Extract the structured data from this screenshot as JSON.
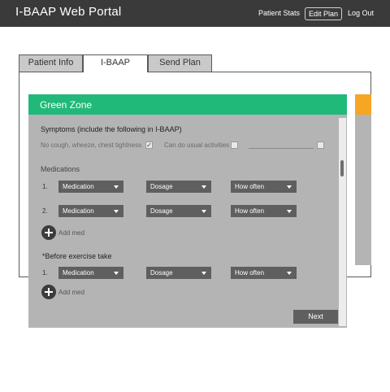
{
  "header": {
    "title": "I-BAAP Web Portal",
    "nav": {
      "patient_stats": "Patient Stats",
      "edit_plan": "Edit Plan",
      "log_out": "Log Out"
    }
  },
  "tabs": [
    {
      "label": "Patient Info"
    },
    {
      "label": "I-BAAP"
    },
    {
      "label": "Send Plan"
    }
  ],
  "card": {
    "title": "Green Zone",
    "symptoms": {
      "title": "Symptoms (include the following in I-BAAP)",
      "items": [
        {
          "label": "No cough, wheeze, chest tightness",
          "check": "✓"
        },
        {
          "label": "Can do usual activities",
          "check": ""
        }
      ]
    },
    "medications": {
      "title": "Medications",
      "rows": [
        {
          "num": "1.",
          "medication": "Medication",
          "dosage": "Dosage",
          "how_often": "How often"
        },
        {
          "num": "2.",
          "medication": "Medication",
          "dosage": "Dosage",
          "how_often": "How often"
        }
      ],
      "add_label": "Add med"
    },
    "before_exercise": {
      "title": "*Before exercise take",
      "rows": [
        {
          "num": "1.",
          "medication": "Medication",
          "dosage": "Dosage",
          "how_often": "How often"
        }
      ],
      "add_label": "Add med"
    },
    "next_label": "Next"
  },
  "colors": {
    "header_bg": "#3a3a3a",
    "green_zone": "#21b97a",
    "yellow_zone": "#f5a623",
    "card_bg": "#b4b4b4"
  }
}
